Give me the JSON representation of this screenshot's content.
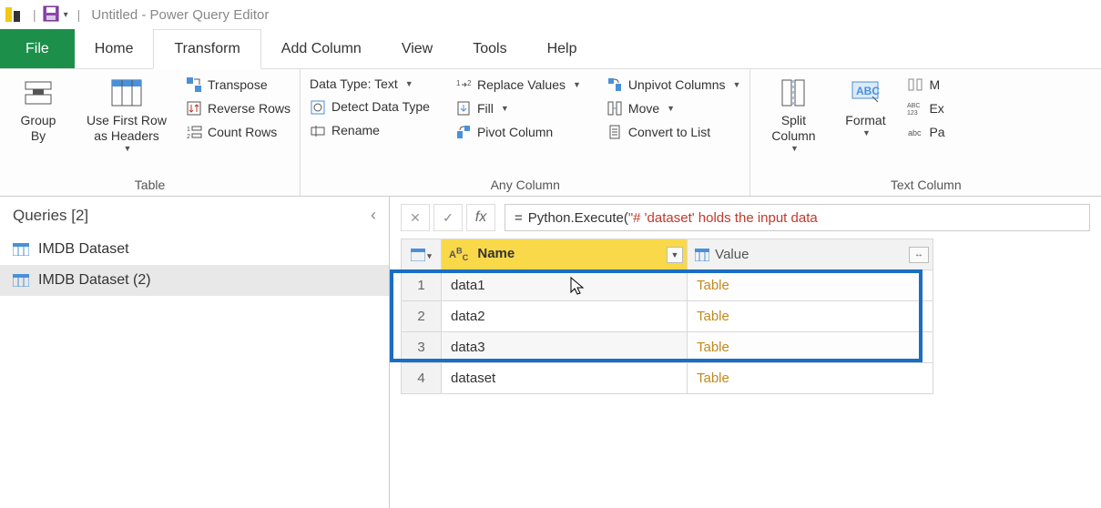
{
  "title": {
    "document": "Untitled",
    "app": "Power Query Editor"
  },
  "tabs": {
    "file": "File",
    "home": "Home",
    "transform": "Transform",
    "add_column": "Add Column",
    "view": "View",
    "tools": "Tools",
    "help": "Help",
    "active": "transform"
  },
  "ribbon": {
    "table": {
      "label": "Table",
      "group_by": "Group\nBy",
      "use_first_row": "Use First Row\nas Headers",
      "transpose": "Transpose",
      "reverse_rows": "Reverse Rows",
      "count_rows": "Count Rows"
    },
    "any_column": {
      "label": "Any Column",
      "data_type": "Data Type: Text",
      "detect": "Detect Data Type",
      "rename": "Rename",
      "replace": "Replace Values",
      "fill": "Fill",
      "pivot": "Pivot Column",
      "unpivot": "Unpivot Columns",
      "move": "Move",
      "convert_list": "Convert to List"
    },
    "text_column": {
      "label": "Text Column",
      "split": "Split\nColumn",
      "format": "Format",
      "merge_short": "M",
      "extract_short": "Ex",
      "parse_short": "Pa"
    }
  },
  "queries": {
    "header": "Queries [2]",
    "items": [
      {
        "label": "IMDB Dataset",
        "selected": false
      },
      {
        "label": "IMDB Dataset (2)",
        "selected": true
      }
    ]
  },
  "formula": {
    "prefix": "= ",
    "call": "Python.Execute",
    "open": "(",
    "string": "\"# 'dataset' holds the input data "
  },
  "grid": {
    "columns": [
      {
        "key": "name",
        "label": "Name",
        "type": "ABC"
      },
      {
        "key": "value",
        "label": "Value",
        "type": "table"
      }
    ],
    "rows": [
      {
        "n": "1",
        "name": "data1",
        "value": "Table"
      },
      {
        "n": "2",
        "name": "data2",
        "value": "Table"
      },
      {
        "n": "3",
        "name": "data3",
        "value": "Table"
      },
      {
        "n": "4",
        "name": "dataset",
        "value": "Table"
      }
    ],
    "highlight_rows": 3
  }
}
